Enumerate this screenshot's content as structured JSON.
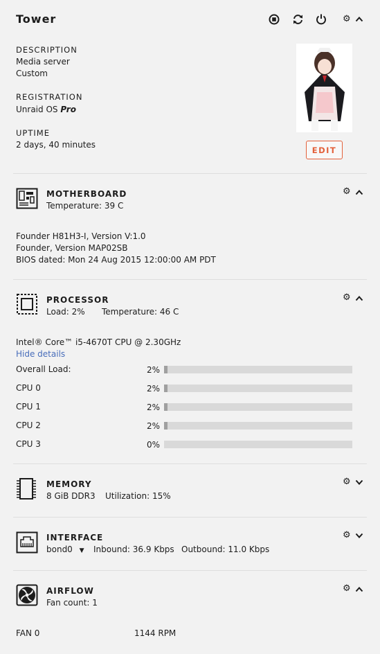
{
  "server": {
    "name": "Tower",
    "description_label": "DESCRIPTION",
    "description_line1": "Media server",
    "description_line2": "Custom",
    "registration_label": "REGISTRATION",
    "registration_prefix": "Unraid OS",
    "registration_edition": "Pro",
    "uptime_label": "UPTIME",
    "uptime_value": "2 days, 40 minutes",
    "edit_label": "EDIT"
  },
  "motherboard": {
    "title": "MOTHERBOARD",
    "temperature": "Temperature: 39 C",
    "line1": "Founder H81H3-I, Version V:1.0",
    "line2": "Founder, Version MAP02SB",
    "line3": "BIOS dated: Mon 24 Aug 2015 12:00:00 AM PDT"
  },
  "processor": {
    "title": "PROCESSOR",
    "load": "Load: 2%",
    "temperature": "Temperature: 46 C",
    "model": "Intel® Core™ i5-4670T CPU @ 2.30GHz",
    "hide_details": "Hide details",
    "rows": [
      {
        "label": "Overall Load:",
        "value": "2%",
        "fraction": 0.02
      },
      {
        "label": "CPU 0",
        "value": "2%",
        "fraction": 0.02
      },
      {
        "label": "CPU 1",
        "value": "2%",
        "fraction": 0.02
      },
      {
        "label": "CPU 2",
        "value": "2%",
        "fraction": 0.02
      },
      {
        "label": "CPU 3",
        "value": "0%",
        "fraction": 0.0
      }
    ]
  },
  "memory": {
    "title": "MEMORY",
    "size": "8 GiB DDR3",
    "utilization": "Utilization: 15%"
  },
  "interface": {
    "title": "INTERFACE",
    "selected": "bond0",
    "inbound": "Inbound: 36.9 Kbps",
    "outbound": "Outbound: 11.0 Kbps"
  },
  "airflow": {
    "title": "AIRFLOW",
    "fan_count": "Fan count: 1",
    "fan_label": "FAN 0",
    "fan_value": "1144 RPM"
  },
  "colors": {
    "accent": "#e3603a",
    "link": "#486dba",
    "bar_track": "#d9d9d9",
    "bar_fill": "#a0a0a0"
  }
}
